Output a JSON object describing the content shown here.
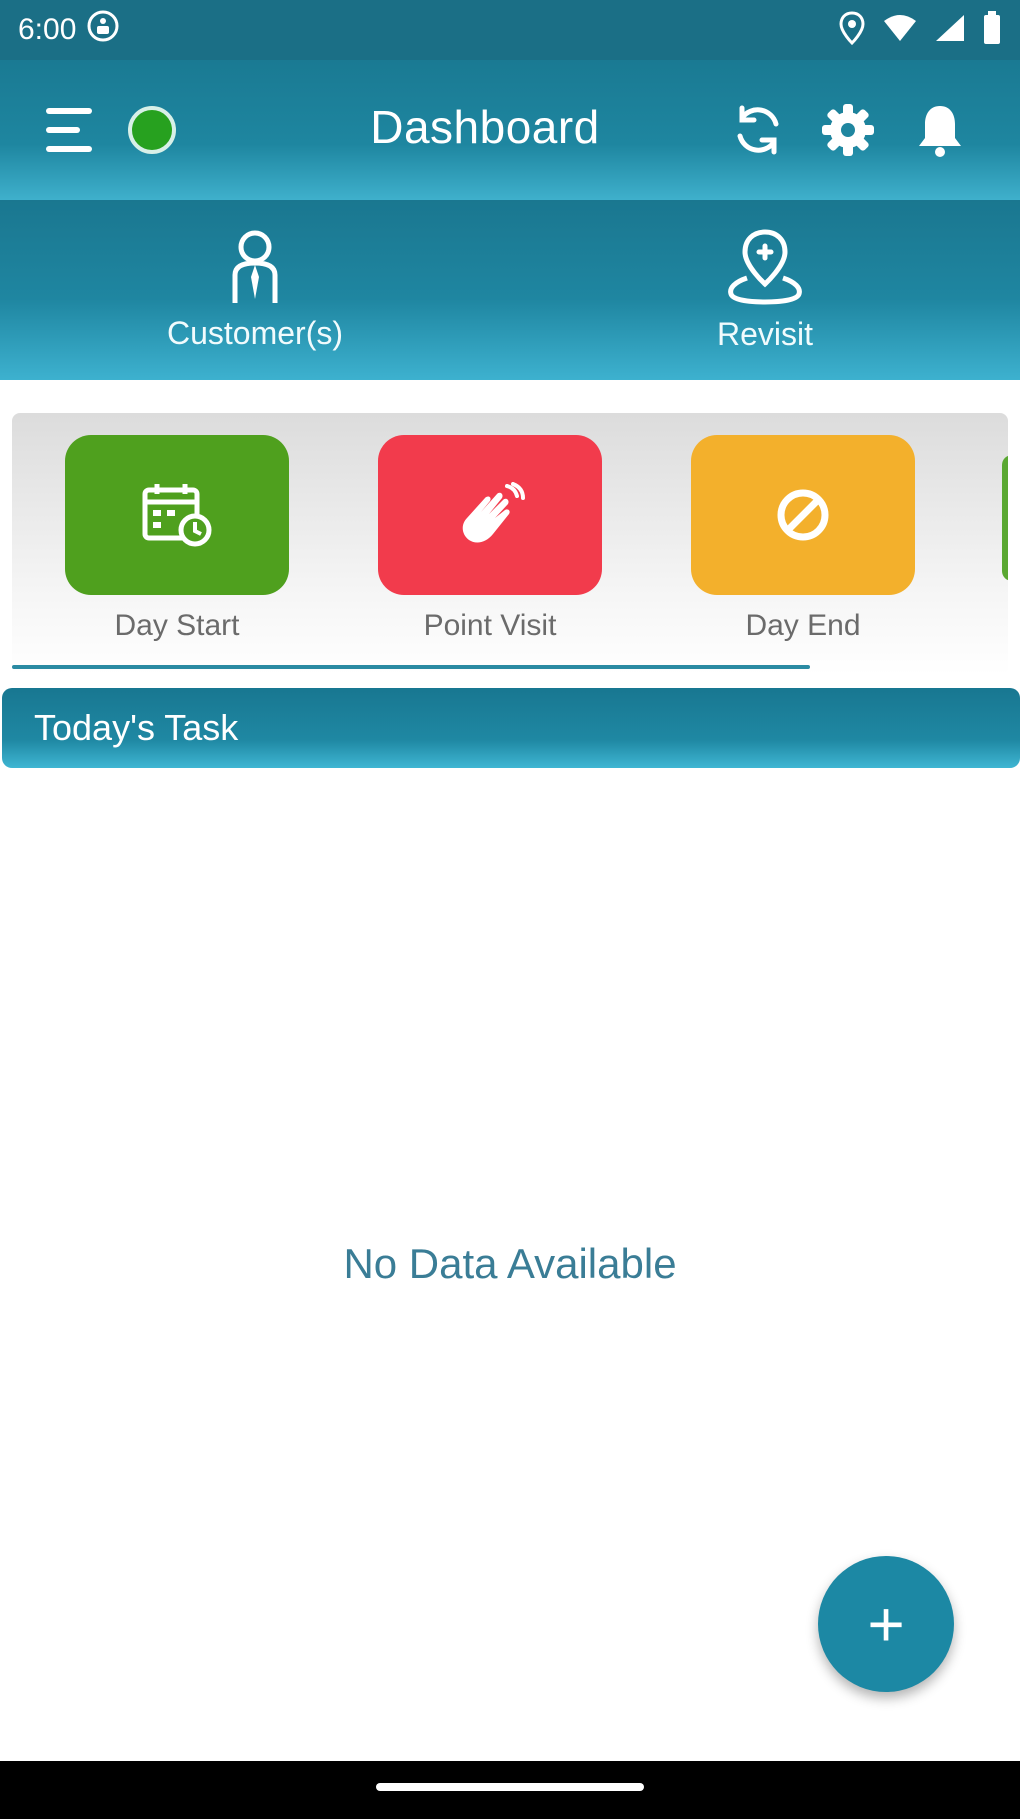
{
  "status_bar": {
    "time": "6:00"
  },
  "app_bar": {
    "title": "Dashboard",
    "online_color": "#27a11f"
  },
  "tabs": [
    {
      "label": "Customer(s)",
      "icon": "customer-icon"
    },
    {
      "label": "Revisit",
      "icon": "revisit-location-icon"
    }
  ],
  "quick_actions": [
    {
      "label": "Day Start",
      "color": "#4fa01e",
      "icon": "calendar-clock-icon"
    },
    {
      "label": "Point Visit",
      "color": "#f23b4c",
      "icon": "hand-wave-icon"
    },
    {
      "label": "Day End",
      "color": "#f3b02c",
      "icon": "block-icon"
    }
  ],
  "tasks": {
    "header": "Today's Task",
    "empty_text": "No Data Available"
  },
  "fab": {
    "label": "+"
  },
  "colors": {
    "primary": "#1c88a4",
    "status_bar": "#1b6f86"
  }
}
